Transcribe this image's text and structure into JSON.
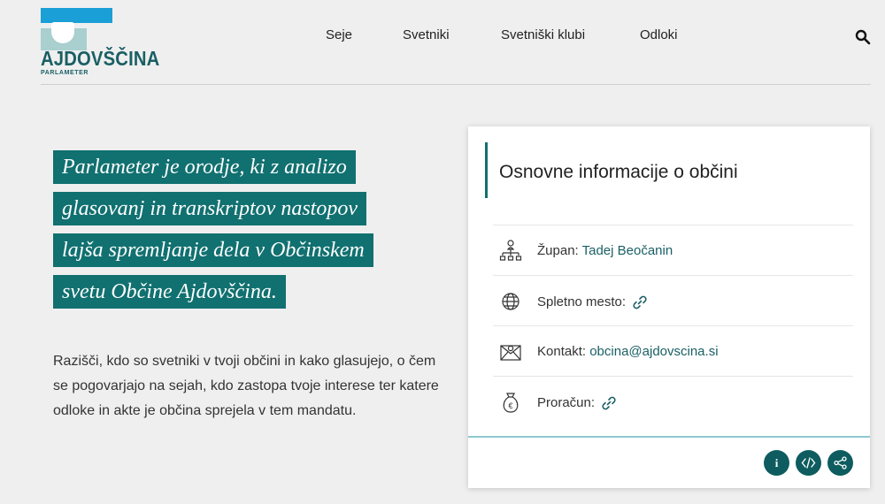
{
  "logo": {
    "wordmark": "AJDOVŠČINA",
    "subtitle": "PARLAMETER"
  },
  "nav": {
    "items": [
      "Seje",
      "Svetniki",
      "Svetniški klubi",
      "Odloki"
    ]
  },
  "hero": {
    "lines": [
      "Parlameter je orodje, ki z analizo",
      "glasovanj in transkriptov nastopov",
      "lajša spremljanje dela v Občinskem",
      "svetu Občine Ajdovščina."
    ],
    "intro": "Razišči, kdo so svetniki v tvoji občini in kako glasujejo, o čem se pogovarjajo na sejah, kdo zastopa tvoje interese ter katere odloke in akte je občina sprejela v tem mandatu."
  },
  "card": {
    "title": "Osnovne informacije o občini",
    "rows": [
      {
        "label": "Župan:",
        "value": "Tadej Beočanin",
        "icon": "org-chart-icon"
      },
      {
        "label": "Spletno mesto:",
        "value": "",
        "icon": "globe-icon"
      },
      {
        "label": "Kontakt:",
        "value": "obcina@ajdovscina.si",
        "icon": "envelope-icon"
      },
      {
        "label": "Proračun:",
        "value": "",
        "icon": "money-bag-icon"
      }
    ],
    "buttons": [
      {
        "name": "info",
        "label": "i"
      },
      {
        "name": "embed",
        "icon": "code-icon"
      },
      {
        "name": "share",
        "icon": "share-icon"
      }
    ]
  },
  "colors": {
    "accent": "#117070",
    "logo_blue": "#1a9fd6",
    "background": "#efefef"
  }
}
